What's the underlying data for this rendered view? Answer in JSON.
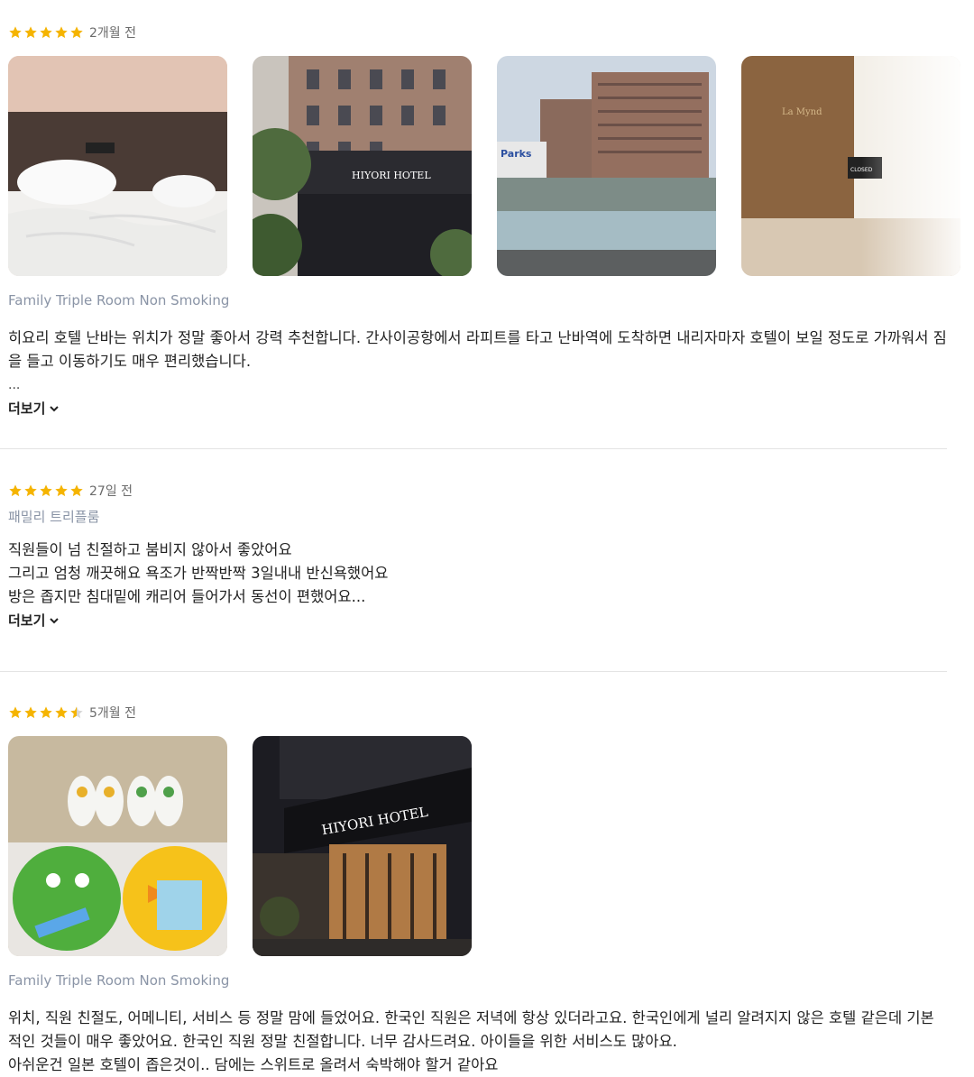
{
  "reviews": [
    {
      "stars": 5,
      "date": "2개월 전",
      "room": "Family Triple Room Non Smoking",
      "text": "히요리 호텔 난바는 위치가 정말 좋아서 강력 추천합니다. 간사이공항에서 라피트를 타고 난바역에 도착하면 내리자마자 호텔이 보일 정도로 가까워서 짐을 들고 이동하기도 매우 편리했습니다.",
      "ellipsis": "...",
      "more_label": "더보기",
      "photo_texts": [
        "HIYORI HOTEL",
        "Parks",
        "La Mynd",
        "CLOSED"
      ]
    },
    {
      "stars": 5,
      "date": "27일 전",
      "room": "패밀리 트리플룸",
      "text": "직원들이 넘 친절하고 붐비지 않아서 좋았어요\n그리고 엄청 깨끗해요 욕조가 반짝반짝 3일내내 반신욕했어요\n방은 좁지만 침대밑에 캐리어 들어가서 동선이 편했어요...",
      "more_label": "더보기"
    },
    {
      "stars": 4.5,
      "date": "5개월 전",
      "room": "Family Triple Room Non Smoking",
      "text": "위치, 직원 친절도, 어메니티, 서비스 등 정말 맘에 들었어요. 한국인 직원은 저녁에 항상 있더라고요. 한국인에게 널리 알려지지 않은 호텔 같은데 기본적인 것들이 매우 좋았어요. 한국인 직원 정말 친절합니다. 너무 감사드려요. 아이들을 위한 서비스도 많아요.\n아쉬운건 일본 호텔이 좁은것이.. 담에는 스위트로 올려서 숙박해야 할거 같아요",
      "photo_texts": [
        "HIYORI HOTEL"
      ]
    }
  ],
  "colors": {
    "star": "#f5b400",
    "star_empty": "#d6d6d6",
    "room_label": "#8a94a6"
  }
}
